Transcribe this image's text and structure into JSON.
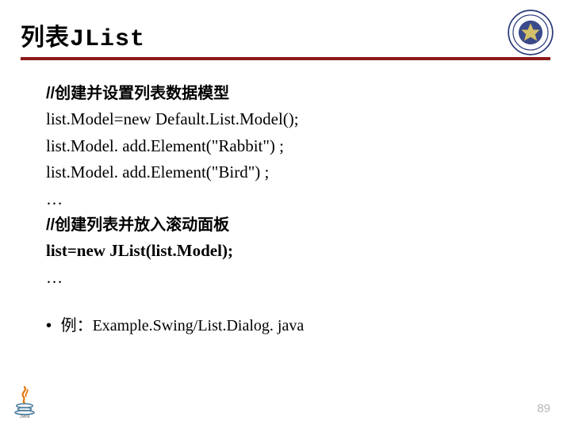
{
  "title": {
    "cn": "列表",
    "mono": "JList"
  },
  "lines": {
    "c1": "//创建并设置列表数据模型",
    "l1": "list.Model=new Default.List.Model();",
    "l2": "list.Model. add.Element(\"Rabbit\") ;",
    "l3": "list.Model. add.Element(\"Bird\") ;",
    "d1": "…",
    "c2": "//创建列表并放入滚动面板",
    "l4": "list=new JList(list.Model);",
    "d2": "…"
  },
  "example": {
    "bullet": "•",
    "label": "例：",
    "path": "Example.Swing/List.Dialog. java"
  },
  "page": "89"
}
